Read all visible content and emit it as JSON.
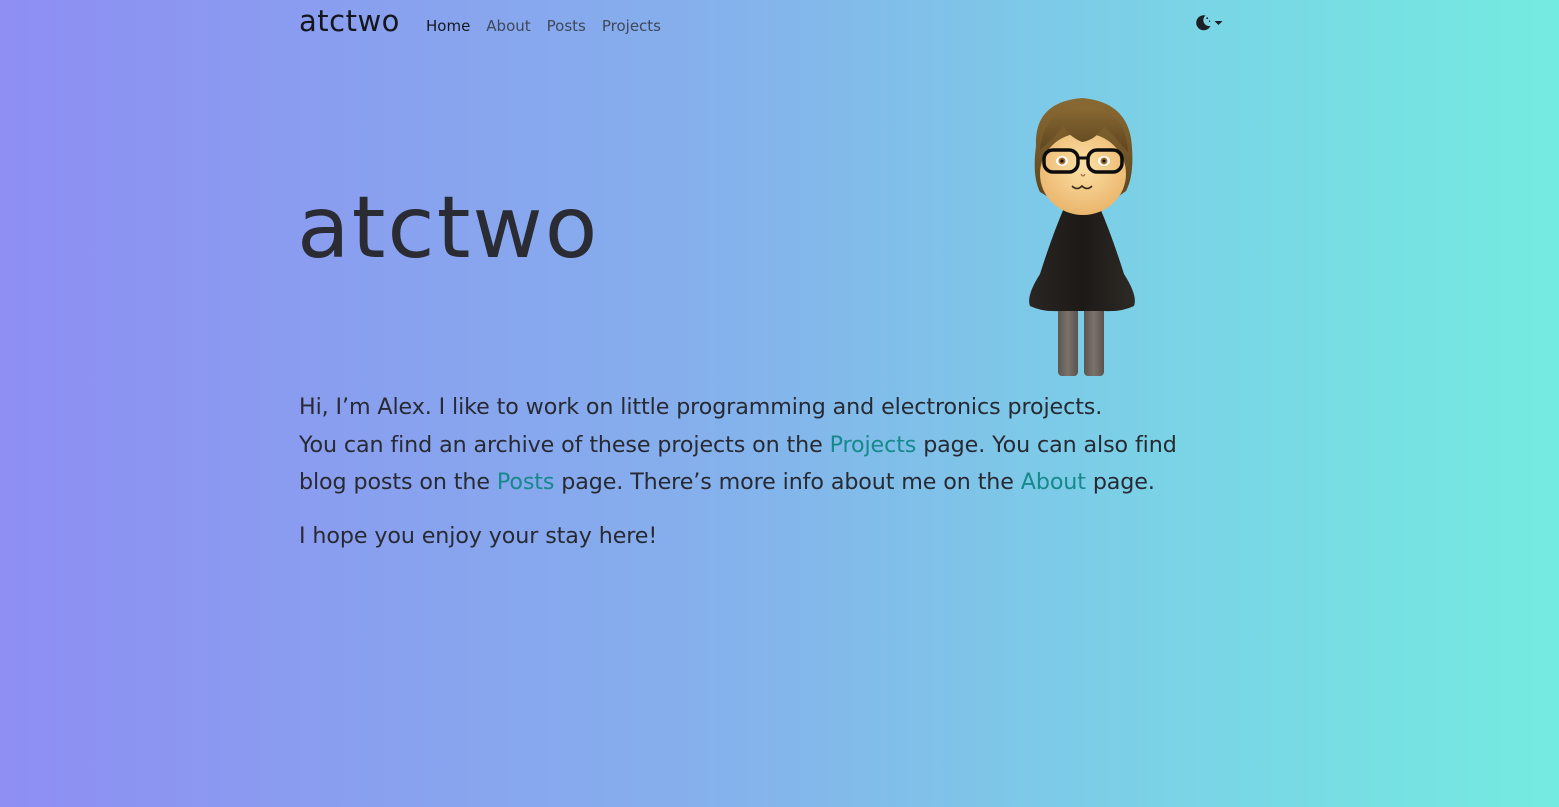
{
  "nav": {
    "brand": "atctwo",
    "links": [
      {
        "label": "Home"
      },
      {
        "label": "About"
      },
      {
        "label": "Posts"
      },
      {
        "label": "Projects"
      }
    ],
    "active": "Home"
  },
  "theme_toggle": {
    "icon": "moon-icon",
    "caret": "chevron-down-icon"
  },
  "hero": {
    "title": "atctwo"
  },
  "intro": {
    "line1": "Hi, I’m Alex. I like to work on little programming and electronics projects.",
    "line2_a": "You can find an archive of these projects on the ",
    "projects_link": "Projects",
    "line2_b": " page. You can also find blog posts on the ",
    "posts_link": "Posts",
    "line2_c": " page. There’s more info about me on the ",
    "about_link": "About",
    "line2_d": " page.",
    "closing": "I hope you enjoy your stay here!"
  },
  "colors": {
    "link": "#16898b",
    "text": "#282a33",
    "gradient_start": "#8e8ef3",
    "gradient_end": "#74ebe0"
  }
}
